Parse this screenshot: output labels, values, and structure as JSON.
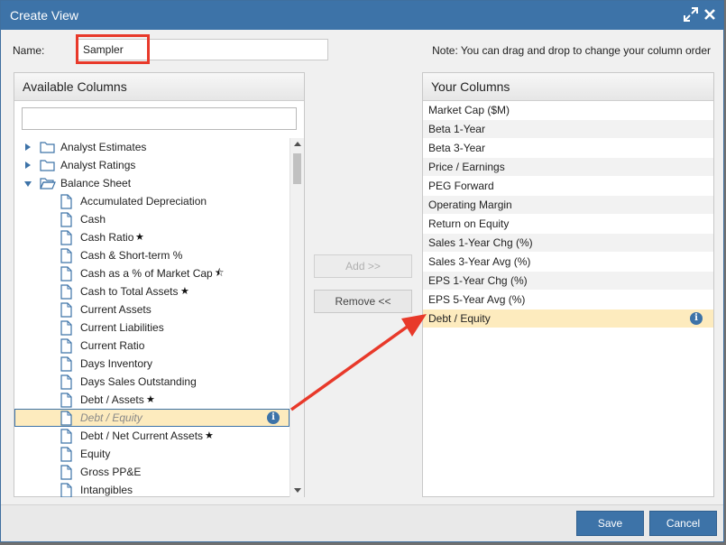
{
  "dialog": {
    "title": "Create View",
    "name_label": "Name:",
    "name_value": "Sampler",
    "note": "Note: You can drag and drop to change your column order"
  },
  "available": {
    "header": "Available Columns",
    "filter_value": "",
    "items": [
      {
        "label": "Analyst Estimates",
        "type": "folder",
        "state": "collapsed"
      },
      {
        "label": "Analyst Ratings",
        "type": "folder",
        "state": "collapsed"
      },
      {
        "label": "Balance Sheet",
        "type": "folder",
        "state": "expanded"
      },
      {
        "label": "Accumulated Depreciation",
        "type": "file"
      },
      {
        "label": "Cash",
        "type": "file"
      },
      {
        "label": "Cash Ratio",
        "type": "file",
        "star": "full"
      },
      {
        "label": "Cash & Short-term %",
        "type": "file"
      },
      {
        "label": "Cash as a % of Market Cap",
        "type": "file",
        "star": "half"
      },
      {
        "label": "Cash to Total Assets",
        "type": "file",
        "star": "full"
      },
      {
        "label": "Current Assets",
        "type": "file"
      },
      {
        "label": "Current Liabilities",
        "type": "file"
      },
      {
        "label": "Current Ratio",
        "type": "file"
      },
      {
        "label": "Days Inventory",
        "type": "file"
      },
      {
        "label": "Days Sales Outstanding",
        "type": "file"
      },
      {
        "label": "Debt / Assets",
        "type": "file",
        "star": "full"
      },
      {
        "label": "Debt / Equity",
        "type": "file",
        "selected": true,
        "info": true
      },
      {
        "label": "Debt / Net Current Assets",
        "type": "file",
        "star": "full"
      },
      {
        "label": "Equity",
        "type": "file"
      },
      {
        "label": "Gross PP&E",
        "type": "file"
      },
      {
        "label": "Intangibles",
        "type": "file"
      }
    ]
  },
  "actions": {
    "add_label": "Add >>",
    "remove_label": "Remove <<"
  },
  "selected": {
    "header": "Your Columns",
    "items": [
      {
        "label": "Market Cap ($M)"
      },
      {
        "label": "Beta 1-Year"
      },
      {
        "label": "Beta 3-Year"
      },
      {
        "label": "Price / Earnings"
      },
      {
        "label": "PEG Forward"
      },
      {
        "label": "Operating Margin"
      },
      {
        "label": "Return on Equity"
      },
      {
        "label": "Sales 1-Year Chg (%)"
      },
      {
        "label": "Sales 3-Year Avg (%)"
      },
      {
        "label": "EPS 1-Year Chg (%)"
      },
      {
        "label": "EPS 5-Year Avg (%)"
      },
      {
        "label": "Debt / Equity",
        "selected": true,
        "info": true
      }
    ]
  },
  "footer": {
    "save_label": "Save",
    "cancel_label": "Cancel"
  },
  "colors": {
    "accent": "#3d73a8",
    "selection": "#fdebbe",
    "annotation": "#e8392a"
  },
  "icons": {
    "star": "★",
    "half_star": "⯪",
    "info": "i"
  }
}
